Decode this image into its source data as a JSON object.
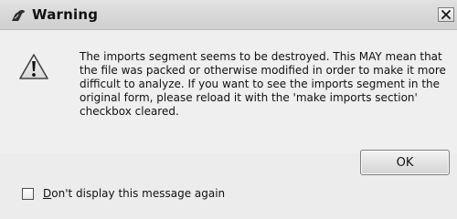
{
  "window": {
    "title": "Warning",
    "icons": {
      "app": "app-icon",
      "close": "close-icon",
      "warning": "warning-icon"
    }
  },
  "message": {
    "text": "The imports segment seems to be destroyed. This MAY mean that the file was packed or otherwise modified in order to make it more difficult to analyze. If you want to see the imports segment in the original form, please reload it with the 'make imports section' checkbox cleared."
  },
  "buttons": {
    "ok_label": "OK"
  },
  "checkbox": {
    "mnemonic": "D",
    "label_rest": "on't display this message again",
    "checked": false
  },
  "colors": {
    "window_background": "#ececec",
    "title_bar": "#d9d9d9",
    "text": "#111111"
  }
}
